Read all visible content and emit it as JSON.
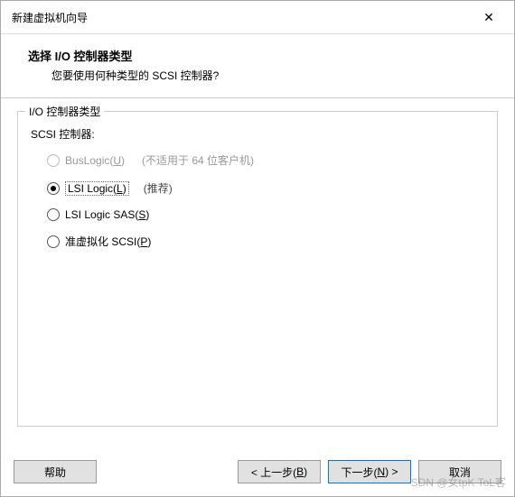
{
  "titlebar": {
    "title": "新建虚拟机向导",
    "close_label": "✕"
  },
  "header": {
    "title": "选择 I/O 控制器类型",
    "subtitle": "您要使用何种类型的 SCSI 控制器?"
  },
  "fieldset": {
    "legend": "I/O 控制器类型",
    "sublabel": "SCSI 控制器:",
    "options": [
      {
        "label_pre": "BusLogic(",
        "accel": "U",
        "label_post": ")",
        "hint": "(不适用于 64 位客户机)",
        "disabled": true,
        "selected": false
      },
      {
        "label_pre": "LSI Logic(",
        "accel": "L",
        "label_post": ")",
        "hint": "(推荐)",
        "disabled": false,
        "selected": true
      },
      {
        "label_pre": "LSI Logic SAS(",
        "accel": "S",
        "label_post": ")",
        "hint": "",
        "disabled": false,
        "selected": false
      },
      {
        "label_pre": "准虚拟化 SCSI(",
        "accel": "P",
        "label_post": ")",
        "hint": "",
        "disabled": false,
        "selected": false
      }
    ]
  },
  "footer": {
    "help": "帮助",
    "back_pre": "< 上一步(",
    "back_accel": "B",
    "back_post": ")",
    "next_pre": "下一步(",
    "next_accel": "N",
    "next_post": ") >",
    "cancel": "取消"
  },
  "watermark": "SDN @女tpK ToL客"
}
